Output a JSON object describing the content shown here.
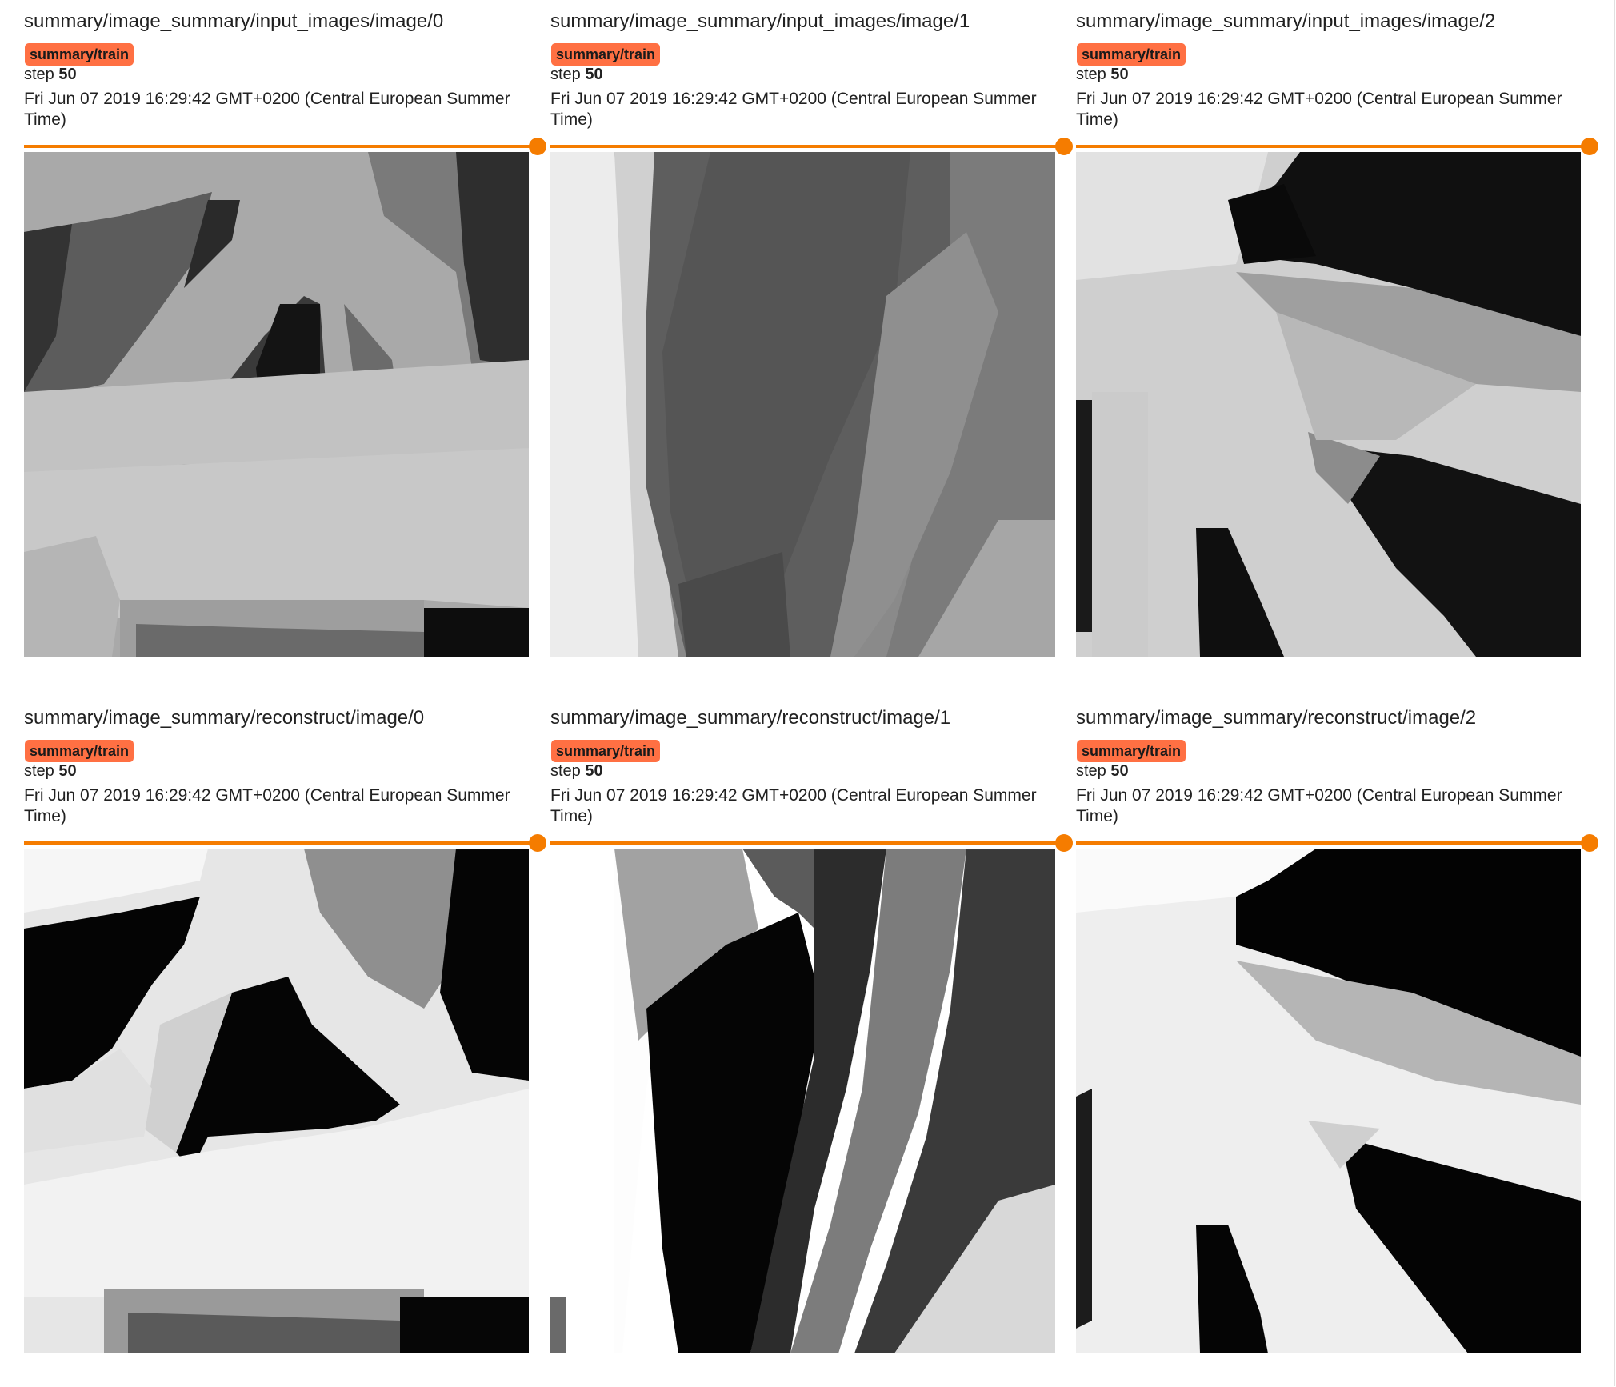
{
  "rows": [
    {
      "cards": [
        {
          "title": "summary/image_summary/input_images/image/0",
          "run": "summary/train",
          "step_label": "step",
          "step_value": "50",
          "timestamp": "Fri Jun 07 2019 16:29:42 GMT+0200 (Central European Summer Time)",
          "slider_value": 1.0
        },
        {
          "title": "summary/image_summary/input_images/image/1",
          "run": "summary/train",
          "step_label": "step",
          "step_value": "50",
          "timestamp": "Fri Jun 07 2019 16:29:42 GMT+0200 (Central European Summer Time)",
          "slider_value": 1.0
        },
        {
          "title": "summary/image_summary/input_images/image/2",
          "run": "summary/train",
          "step_label": "step",
          "step_value": "50",
          "timestamp": "Fri Jun 07 2019 16:29:42 GMT+0200 (Central European Summer Time)",
          "slider_value": 1.0
        }
      ]
    },
    {
      "cards": [
        {
          "title": "summary/image_summary/reconstruct/image/0",
          "run": "summary/train",
          "step_label": "step",
          "step_value": "50",
          "timestamp": "Fri Jun 07 2019 16:29:42 GMT+0200 (Central European Summer Time)",
          "slider_value": 1.0
        },
        {
          "title": "summary/image_summary/reconstruct/image/1",
          "run": "summary/train",
          "step_label": "step",
          "step_value": "50",
          "timestamp": "Fri Jun 07 2019 16:29:42 GMT+0200 (Central European Summer Time)",
          "slider_value": 1.0
        },
        {
          "title": "summary/image_summary/reconstruct/image/2",
          "run": "summary/train",
          "step_label": "step",
          "step_value": "50",
          "timestamp": "Fri Jun 07 2019 16:29:42 GMT+0200 (Central European Summer Time)",
          "slider_value": 1.0
        }
      ]
    }
  ],
  "colors": {
    "run_badge": "#ff7043",
    "slider": "#f57c00",
    "text": "#212121"
  }
}
